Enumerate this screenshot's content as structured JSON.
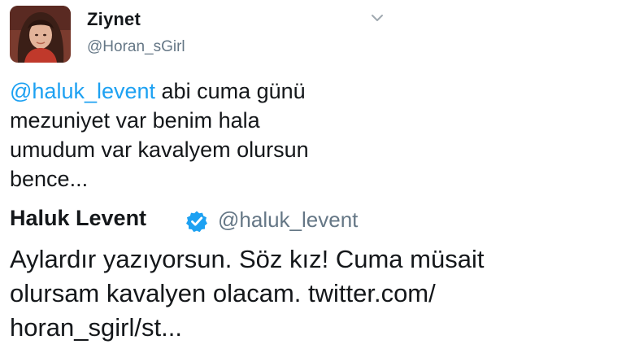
{
  "tweet": {
    "author_name": "Ziynet",
    "author_handle": "@Horan_sGirl",
    "avatar_icon": "user-avatar-photo",
    "menu_icon": "chevron-down-icon",
    "text_mention": "@haluk_levent",
    "text_lines": [
      " abi cuma günü",
      "mezuniyet var benim hala",
      "umudum var kavalyem olursun",
      "bence..."
    ]
  },
  "quoted_tweet": {
    "author_name": "Haluk Levent",
    "verified_icon": "verified-badge-icon",
    "author_handle": "@haluk_levent",
    "text_lines": [
      "Aylardır yazıyorsun. Söz kız! Cuma müsait",
      "olursam kavalyen olacam. twitter.com/",
      "horan_sgirl/st..."
    ]
  },
  "colors": {
    "link": "#1da1f2",
    "text": "#14171a",
    "secondary": "#657786",
    "verified": "#1da1f2"
  }
}
